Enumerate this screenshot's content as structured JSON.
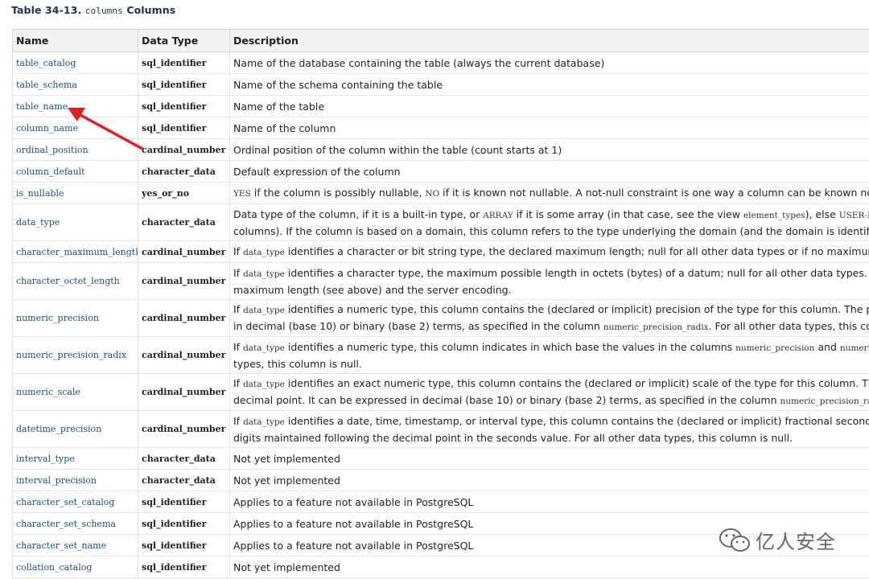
{
  "caption": {
    "prefix": "Table 34-13.",
    "code": "columns",
    "suffix": "Columns"
  },
  "headers": [
    "Name",
    "Data Type",
    "Description"
  ],
  "rows": [
    {
      "name": "table_catalog",
      "type": "sql_identifier",
      "desc": [
        [
          {
            "t": "Name of the database containing the table (always the current database)"
          }
        ]
      ]
    },
    {
      "name": "table_schema",
      "type": "sql_identifier",
      "desc": [
        [
          {
            "t": "Name of the schema containing the table"
          }
        ]
      ]
    },
    {
      "name": "table_name",
      "type": "sql_identifier",
      "desc": [
        [
          {
            "t": "Name of the table"
          }
        ]
      ]
    },
    {
      "name": "column_name",
      "type": "sql_identifier",
      "desc": [
        [
          {
            "t": "Name of the column"
          }
        ]
      ]
    },
    {
      "name": "ordinal_position",
      "type": "cardinal_number",
      "desc": [
        [
          {
            "t": "Ordinal position of the column within the table (count starts at 1)"
          }
        ]
      ]
    },
    {
      "name": "column_default",
      "type": "character_data",
      "desc": [
        [
          {
            "t": "Default expression of the column"
          }
        ]
      ]
    },
    {
      "name": "is_nullable",
      "type": "yes_or_no",
      "desc": [
        [
          {
            "c": "YES"
          },
          {
            "t": " if the column is possibly nullable, "
          },
          {
            "c": "NO"
          },
          {
            "t": " if it is known not nullable. A not-null constraint is one way a column can be known not nu"
          }
        ]
      ]
    },
    {
      "name": "data_type",
      "type": "character_data",
      "desc": [
        [
          {
            "t": "Data type of the column, if it is a built-in type, or "
          },
          {
            "c": "ARRAY"
          },
          {
            "t": " if it is some array (in that case, see the view "
          },
          {
            "c": "element_types"
          },
          {
            "t": "), else "
          },
          {
            "c": "USER-DEFINE"
          }
        ],
        [
          {
            "t": "columns). If the column is based on a domain, this column refers to the type underlying the domain (and the domain is identified"
          }
        ]
      ]
    },
    {
      "name": "character_maximum_length",
      "type": "cardinal_number",
      "desc": [
        [
          {
            "t": "If "
          },
          {
            "c": "data_type"
          },
          {
            "t": " identifies a character or bit string type, the declared maximum length; null for all other data types or if no maximum l"
          }
        ]
      ]
    },
    {
      "name": "character_octet_length",
      "type": "cardinal_number",
      "desc": [
        [
          {
            "t": "If "
          },
          {
            "c": "data_type"
          },
          {
            "t": " identifies a character type, the maximum possible length in octets (bytes) of a datum; null for all other data types. The"
          }
        ],
        [
          {
            "t": "maximum length (see above) and the server encoding."
          }
        ]
      ]
    },
    {
      "name": "numeric_precision",
      "type": "cardinal_number",
      "desc": [
        [
          {
            "t": "If "
          },
          {
            "c": "data_type"
          },
          {
            "t": " identifies a numeric type, this column contains the (declared or implicit) precision of the type for this column. The pre"
          }
        ],
        [
          {
            "t": "in decimal (base 10) or binary (base 2) terms, as specified in the column "
          },
          {
            "c": "numeric_precision_radix"
          },
          {
            "t": ". For all other data types, this colu"
          }
        ]
      ]
    },
    {
      "name": "numeric_precision_radix",
      "type": "cardinal_number",
      "desc": [
        [
          {
            "t": "If "
          },
          {
            "c": "data_type"
          },
          {
            "t": " identifies a numeric type, this column indicates in which base the values in the columns "
          },
          {
            "c": "numeric_precision"
          },
          {
            "t": " and "
          },
          {
            "c": "numeric_"
          }
        ],
        [
          {
            "t": "types, this column is null."
          }
        ]
      ]
    },
    {
      "name": "numeric_scale",
      "type": "cardinal_number",
      "desc": [
        [
          {
            "t": "If "
          },
          {
            "c": "data_type"
          },
          {
            "t": " identifies an exact numeric type, this column contains the (declared or implicit) scale of the type for this column. The s"
          }
        ],
        [
          {
            "t": "decimal point. It can be expressed in decimal (base 10) or binary (base 2) terms, as specified in the column "
          },
          {
            "c": "numeric_precision_radi"
          }
        ]
      ]
    },
    {
      "name": "datetime_precision",
      "type": "cardinal_number",
      "desc": [
        [
          {
            "t": "If "
          },
          {
            "c": "data_type"
          },
          {
            "t": " identifies a date, time, timestamp, or interval type, this column contains the (declared or implicit) fractional seconds p"
          }
        ],
        [
          {
            "t": "digits maintained following the decimal point in the seconds value. For all other data types, this column is null."
          }
        ]
      ]
    },
    {
      "name": "interval_type",
      "type": "character_data",
      "desc": [
        [
          {
            "t": "Not yet implemented"
          }
        ]
      ]
    },
    {
      "name": "interval_precision",
      "type": "character_data",
      "desc": [
        [
          {
            "t": "Not yet implemented"
          }
        ]
      ]
    },
    {
      "name": "character_set_catalog",
      "type": "sql_identifier",
      "desc": [
        [
          {
            "t": "Applies to a feature not available in PostgreSQL"
          }
        ]
      ]
    },
    {
      "name": "character_set_schema",
      "type": "sql_identifier",
      "desc": [
        [
          {
            "t": "Applies to a feature not available in PostgreSQL"
          }
        ]
      ]
    },
    {
      "name": "character_set_name",
      "type": "sql_identifier",
      "desc": [
        [
          {
            "t": "Applies to a feature not available in PostgreSQL"
          }
        ]
      ]
    },
    {
      "name": "collation_catalog",
      "type": "sql_identifier",
      "desc": [
        [
          {
            "t": "Not yet implemented"
          }
        ]
      ]
    }
  ],
  "annotation": {
    "target": "table_name",
    "color": "#e02020"
  },
  "watermark": {
    "text": "亿人安全",
    "icon": "wechat-logo-icon"
  }
}
